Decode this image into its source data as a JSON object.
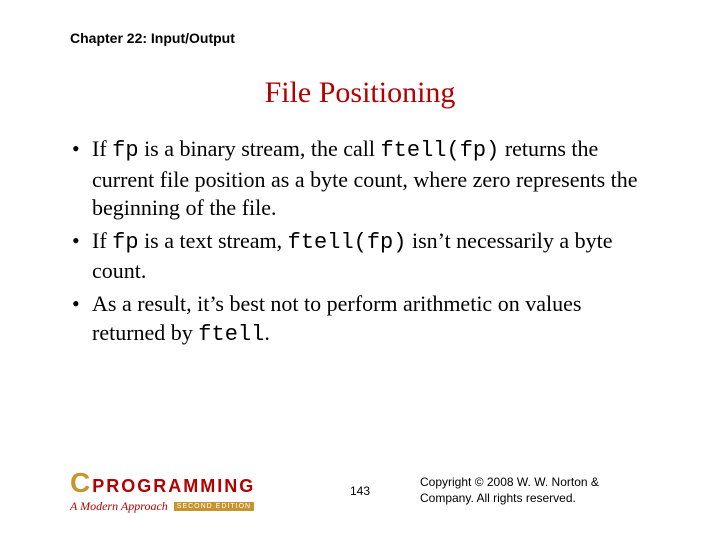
{
  "chapter": "Chapter 22: Input/Output",
  "title": "File Positioning",
  "bullets": [
    {
      "pre": "If ",
      "code1": "fp",
      "mid1": " is a binary stream, the call ",
      "code2": "ftell(fp)",
      "mid2": " returns the current file position as a byte count, where zero represents the beginning of the file.",
      "code3": "",
      "post": ""
    },
    {
      "pre": "If ",
      "code1": "fp",
      "mid1": " is a text stream, ",
      "code2": "ftell(fp)",
      "mid2": " isn’t necessarily a byte count.",
      "code3": "",
      "post": ""
    },
    {
      "pre": "As a result, it’s best not to perform arithmetic on values returned by ",
      "code1": "ftell",
      "mid1": ".",
      "code2": "",
      "mid2": "",
      "code3": "",
      "post": ""
    }
  ],
  "logo": {
    "c": "C",
    "programming": "PROGRAMMING",
    "subtitle": "A Modern Approach",
    "edition": "SECOND EDITION"
  },
  "page": "143",
  "copyright": "Copyright © 2008 W. W. Norton & Company. All rights reserved."
}
